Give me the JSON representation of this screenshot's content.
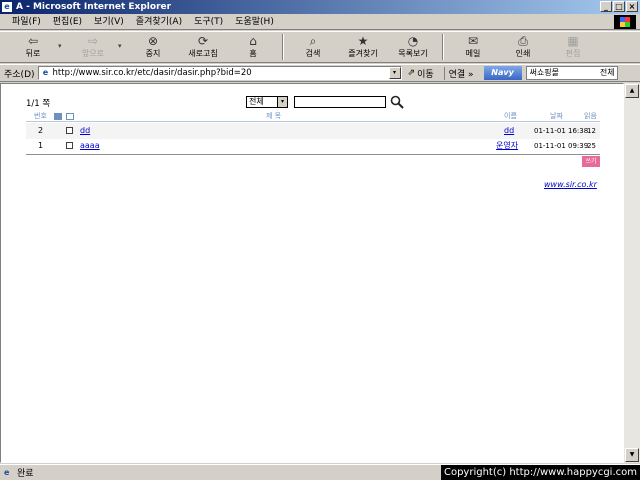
{
  "window": {
    "title": "A - Microsoft Internet Explorer",
    "ie_glyph": "e",
    "buttons": {
      "minimize": "_",
      "maximize": "□",
      "close": "×"
    }
  },
  "menu": [
    "파일(F)",
    "편집(E)",
    "보기(V)",
    "즐겨찾기(A)",
    "도구(T)",
    "도움말(H)"
  ],
  "toolbar": {
    "back": {
      "label": "뒤로",
      "icon": "arrow-left-icon",
      "glyph": "⇦"
    },
    "back_drop": "▾",
    "forward": {
      "label": "앞으로",
      "icon": "arrow-right-icon",
      "glyph": "⇨"
    },
    "forward_drop": "▾",
    "stop": {
      "label": "중지",
      "icon": "stop-icon",
      "glyph": "⊗"
    },
    "refresh": {
      "label": "새로고침",
      "icon": "refresh-icon",
      "glyph": "⟳"
    },
    "home": {
      "label": "홈",
      "icon": "home-icon",
      "glyph": "⌂"
    },
    "search": {
      "label": "검색",
      "icon": "search-icon",
      "glyph": "⌕"
    },
    "favorites": {
      "label": "즐겨찾기",
      "icon": "favorites-icon",
      "glyph": "★"
    },
    "history": {
      "label": "목록보기",
      "icon": "history-icon",
      "glyph": "◔"
    },
    "mail": {
      "label": "메일",
      "icon": "mail-icon",
      "glyph": "✉"
    },
    "print": {
      "label": "인쇄",
      "icon": "print-icon",
      "glyph": "⎙"
    },
    "edit": {
      "label": "편집",
      "icon": "edit-icon",
      "glyph": "▦"
    }
  },
  "address": {
    "label": "주소(D)",
    "icon_glyph": "e",
    "url": "http://www.sir.co.kr/etc/dasir/dasir.php?bid=20",
    "drop": "▾",
    "go_label": "이동",
    "go_glyph": "⇗",
    "links_label": "연결 »",
    "navy_label": "Navy",
    "navy_search_left": "써쇼핑몰",
    "navy_search_right": "전체"
  },
  "board": {
    "page_info": "1/1 쪽",
    "search_select": "전체",
    "search_select_drop": "▾",
    "search_value": "",
    "headers": {
      "no": "번호",
      "subject": "제 목",
      "name": "이름",
      "date": "날짜",
      "hits": "읽음"
    },
    "rows": [
      {
        "no": "2",
        "subject": "dd",
        "name": "dd",
        "date": "01-11-01 16:38",
        "hits": "12"
      },
      {
        "no": "1",
        "subject": "aaaa",
        "name": "운영자",
        "date": "01-11-01 09:39",
        "hits": "25"
      }
    ],
    "write_label": "쓰기",
    "footer_link": "www.sir.co.kr"
  },
  "scrollbar": {
    "up": "▲",
    "down": "▼"
  },
  "status": {
    "text": "완료",
    "icon_glyph": "e"
  },
  "copyright": "Copyright(c) http://www.happycgi.com"
}
